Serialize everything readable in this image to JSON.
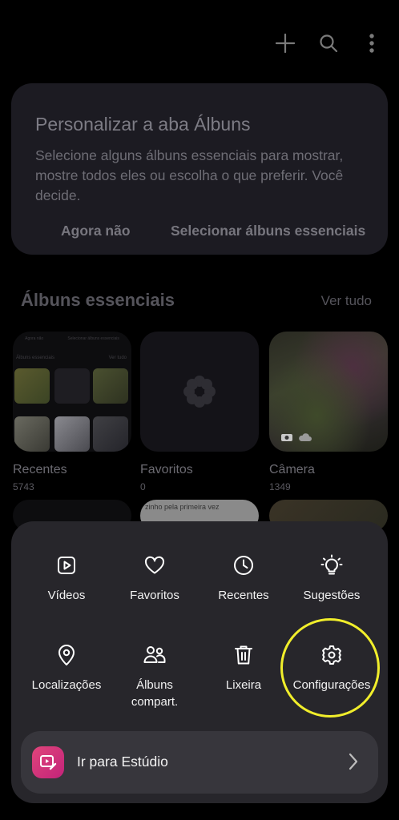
{
  "topbar": {
    "icons": [
      "add-icon",
      "search-icon",
      "more-options-icon"
    ]
  },
  "customize_card": {
    "title": "Personalizar a aba Álbuns",
    "description": "Selecione alguns álbuns essenciais para mostrar, mostre todos eles ou escolha o que preferir. Você decide.",
    "not_now": "Agora não",
    "select": "Selecionar álbuns essenciais"
  },
  "section": {
    "title": "Álbuns essenciais",
    "see_all": "Ver tudo"
  },
  "albums": [
    {
      "name": "Recentes",
      "count": "5743"
    },
    {
      "name": "Favoritos",
      "count": "0"
    },
    {
      "name": "Câmera",
      "count": "1349"
    }
  ],
  "mini_preview": {
    "not_now": "Agora não",
    "select": "Selecionar álbuns essenciais",
    "title": "Álbuns essenciais",
    "see_all": "Ver tudo",
    "partial_caption": "zinho pela primeira vez"
  },
  "menu": {
    "row1": [
      {
        "label": "Vídeos",
        "icon": "video-icon"
      },
      {
        "label": "Favoritos",
        "icon": "heart-icon"
      },
      {
        "label": "Recentes",
        "icon": "clock-icon"
      },
      {
        "label": "Sugestões",
        "icon": "lightbulb-icon"
      }
    ],
    "row2": [
      {
        "label": "Localizações",
        "icon": "location-pin-icon"
      },
      {
        "label": "Álbuns compart.",
        "icon": "people-icon"
      },
      {
        "label": "Lixeira",
        "icon": "trash-icon"
      },
      {
        "label": "Configurações",
        "icon": "gear-icon"
      }
    ],
    "studio": {
      "label": "Ir para Estúdio",
      "icon": "studio-icon"
    }
  },
  "colors": {
    "highlight": "#f1ee2b",
    "studio_brand": "#d93579"
  }
}
